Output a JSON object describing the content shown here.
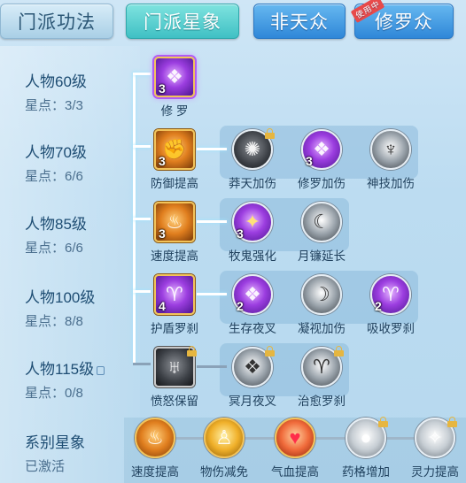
{
  "tabs": [
    {
      "label": "门派功法"
    },
    {
      "label": "门派星象"
    },
    {
      "label": "非天众"
    },
    {
      "label": "修罗众",
      "badge": "使用中"
    }
  ],
  "levels": [
    {
      "title": "人物60级",
      "stars": "星点：3/3"
    },
    {
      "title": "人物70级",
      "stars": "星点：6/6"
    },
    {
      "title": "人物85级",
      "stars": "星点：6/6"
    },
    {
      "title": "人物100级",
      "stars": "星点：8/8"
    },
    {
      "title": "人物115级",
      "stars": "星点：0/8",
      "locked": true
    },
    {
      "title": "系别星象",
      "stars": "已激活"
    }
  ],
  "nodes": {
    "r0": [
      {
        "label": "修 罗",
        "count": "3",
        "icon": "asura-icon"
      }
    ],
    "r1": [
      {
        "label": "防御提高",
        "count": "3",
        "icon": "muscle-icon"
      },
      {
        "label": "莽天加伤",
        "count": "",
        "icon": "dark-beast-icon",
        "locked": true
      },
      {
        "label": "修罗加伤",
        "count": "3",
        "icon": "asura-icon"
      },
      {
        "label": "神技加伤",
        "count": "",
        "icon": "claw-icon"
      }
    ],
    "r2": [
      {
        "label": "速度提高",
        "count": "3",
        "icon": "flame-icon"
      },
      {
        "label": "牧鬼强化",
        "count": "3",
        "icon": "chest-icon"
      },
      {
        "label": "月镰延长",
        "count": "",
        "icon": "sickle-icon"
      }
    ],
    "r3": [
      {
        "label": "护盾罗刹",
        "count": "4",
        "icon": "ram-icon"
      },
      {
        "label": "生存夜叉",
        "count": "2",
        "icon": "asura-icon"
      },
      {
        "label": "凝视加伤",
        "count": "",
        "icon": "crescent-icon"
      },
      {
        "label": "吸收罗刹",
        "count": "2",
        "icon": "ram-icon"
      }
    ],
    "r4": [
      {
        "label": "愤怒保留",
        "count": "",
        "icon": "demon-icon",
        "locked": true
      },
      {
        "label": "冥月夜叉",
        "count": "",
        "icon": "asura-icon",
        "locked": true
      },
      {
        "label": "治愈罗刹",
        "count": "",
        "icon": "ram-icon",
        "locked": true
      }
    ],
    "bottom": [
      {
        "label": "速度提高",
        "icon": "flame-icon"
      },
      {
        "label": "物伤减免",
        "icon": "figure-icon"
      },
      {
        "label": "气血提高",
        "icon": "heart-icon"
      },
      {
        "label": "药格增加",
        "icon": "orb-icon",
        "locked": true
      },
      {
        "label": "灵力提高",
        "icon": "spark-icon",
        "locked": true
      }
    ]
  }
}
